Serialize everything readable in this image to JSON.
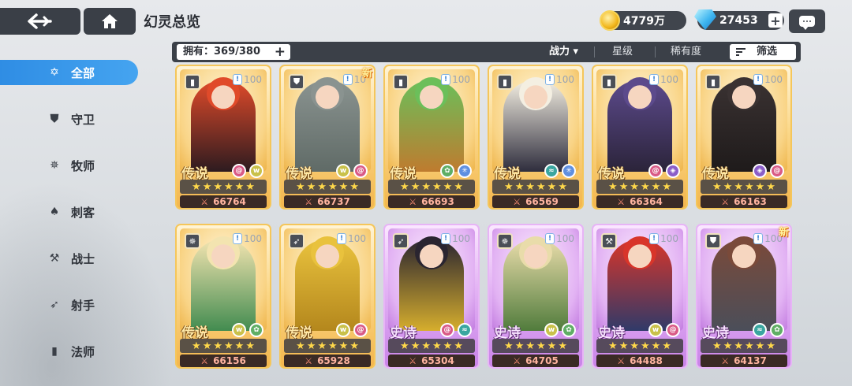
{
  "header": {
    "back_icon": "back-arrow-icon",
    "home_icon": "home-icon",
    "title": "幻灵总览",
    "gold": "4779万",
    "gems": "27453",
    "gem_plus": "+",
    "chat_icon": "chat-icon"
  },
  "colors": {
    "accent": "#3a96ea",
    "dark_panel": "#3b4048",
    "legend_frame": "#f5c65a",
    "epic_frame": "#e7b4f6"
  },
  "sidebar": {
    "items": [
      {
        "label": "全部",
        "icon": "star-outline-icon",
        "active": true
      },
      {
        "label": "守卫",
        "icon": "shield-icon",
        "active": false
      },
      {
        "label": "牧师",
        "icon": "wings-icon",
        "active": false
      },
      {
        "label": "刺客",
        "icon": "claw-icon",
        "active": false
      },
      {
        "label": "战士",
        "icon": "axe-icon",
        "active": false
      },
      {
        "label": "射手",
        "icon": "bow-icon",
        "active": false
      },
      {
        "label": "法师",
        "icon": "book-icon",
        "active": false
      }
    ]
  },
  "filter_bar": {
    "owned": "拥有：369/380",
    "owned_plus": "+",
    "sort_power": "战力 ▾",
    "sort_star": "星级",
    "sort_rarity": "稀有度",
    "filter": "筛选"
  },
  "cards": [
    {
      "rarity": "传说",
      "type": "legend",
      "level": "100",
      "power": "66764",
      "stars": 6,
      "new": "",
      "class_icon": "book-icon",
      "elements": [
        "spiral",
        "wings"
      ],
      "palette": [
        "#e04a2a",
        "#2a1a1f"
      ]
    },
    {
      "rarity": "传说",
      "type": "legend",
      "level": "10",
      "power": "66737",
      "stars": 6,
      "new": "新",
      "class_icon": "shield-icon",
      "elements": [
        "wings",
        "spiral"
      ],
      "palette": [
        "#8a9390",
        "#5f6a66"
      ]
    },
    {
      "rarity": "传说",
      "type": "legend",
      "level": "100",
      "power": "66693",
      "stars": 6,
      "new": "",
      "class_icon": "book-icon",
      "elements": [
        "leaf",
        "snow"
      ],
      "palette": [
        "#6bbf5a",
        "#c07a2e"
      ]
    },
    {
      "rarity": "传说",
      "type": "legend",
      "level": "100",
      "power": "66569",
      "stars": 6,
      "new": "",
      "class_icon": "book-icon",
      "elements": [
        "wave",
        "snow"
      ],
      "palette": [
        "#f4efe2",
        "#2b2a3a"
      ]
    },
    {
      "rarity": "传说",
      "type": "legend",
      "level": "100",
      "power": "66364",
      "stars": 6,
      "new": "",
      "class_icon": "book-icon",
      "elements": [
        "spiral",
        "eye"
      ],
      "palette": [
        "#5c4a8c",
        "#2a2338"
      ]
    },
    {
      "rarity": "传说",
      "type": "legend",
      "level": "100",
      "power": "66163",
      "stars": 6,
      "new": "",
      "class_icon": "book-icon",
      "elements": [
        "eye",
        "spiral"
      ],
      "palette": [
        "#3a3232",
        "#1e1a1a"
      ]
    },
    {
      "rarity": "传说",
      "type": "legend",
      "level": "100",
      "power": "66156",
      "stars": 6,
      "new": "",
      "class_icon": "wings-icon",
      "elements": [
        "wings",
        "leaf"
      ],
      "palette": [
        "#f3e4b0",
        "#3f8a4e"
      ]
    },
    {
      "rarity": "传说",
      "type": "legend",
      "level": "100",
      "power": "65928",
      "stars": 6,
      "new": "",
      "class_icon": "bow-icon",
      "elements": [
        "wings",
        "spiral"
      ],
      "palette": [
        "#e9c23d",
        "#b3861c"
      ]
    },
    {
      "rarity": "史诗",
      "type": "epic",
      "level": "100",
      "power": "65304",
      "stars": 6,
      "new": "",
      "class_icon": "bow-icon",
      "elements": [
        "spiral",
        "wave"
      ],
      "palette": [
        "#2a2530",
        "#d9b02d"
      ]
    },
    {
      "rarity": "史诗",
      "type": "epic",
      "level": "100",
      "power": "64705",
      "stars": 6,
      "new": "",
      "class_icon": "wings-icon",
      "elements": [
        "wings",
        "leaf"
      ],
      "palette": [
        "#e9dcaa",
        "#4e7a3a"
      ]
    },
    {
      "rarity": "史诗",
      "type": "epic",
      "level": "100",
      "power": "64488",
      "stars": 6,
      "new": "",
      "class_icon": "axe-icon",
      "elements": [
        "wings",
        "spiral"
      ],
      "palette": [
        "#d8352a",
        "#2d3a6a"
      ]
    },
    {
      "rarity": "史诗",
      "type": "epic",
      "level": "100",
      "power": "64137",
      "stars": 6,
      "new": "新",
      "class_icon": "shield-icon",
      "elements": [
        "wave",
        "leaf"
      ],
      "palette": [
        "#7a4a3a",
        "#4a4e5a"
      ]
    }
  ]
}
